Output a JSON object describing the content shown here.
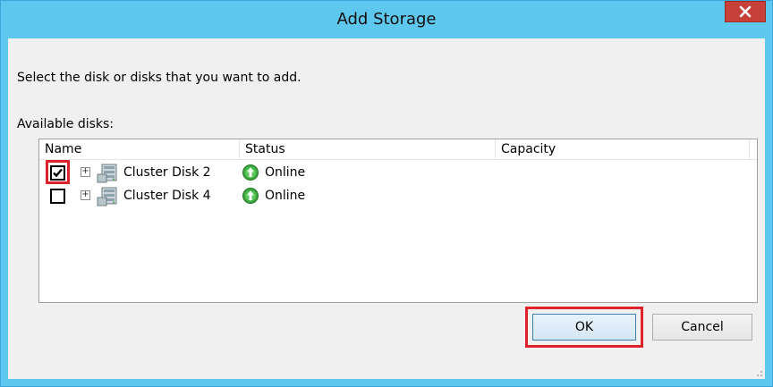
{
  "window": {
    "title": "Add Storage",
    "close_glyph": "x"
  },
  "instruction": "Select the disk or disks that you want to add.",
  "available_label": "Available disks:",
  "table": {
    "columns": [
      "Name",
      "Status",
      "Capacity"
    ],
    "rows": [
      {
        "checked": true,
        "name": "Cluster Disk 2",
        "status": "Online",
        "capacity": ""
      },
      {
        "checked": false,
        "name": "Cluster Disk 4",
        "status": "Online",
        "capacity": ""
      }
    ]
  },
  "buttons": {
    "ok": "OK",
    "cancel": "Cancel"
  },
  "icons": {
    "close": "close-icon",
    "expander": "expand-plus-icon",
    "disk": "cluster-disk-icon",
    "status_online": "online-arrow-up-icon",
    "checkmark": "checkmark-icon"
  },
  "colors": {
    "titlebar": "#5ec7ee",
    "close_button": "#c7403a",
    "highlight": "#e0202b",
    "online_green": "#3aa63a"
  }
}
